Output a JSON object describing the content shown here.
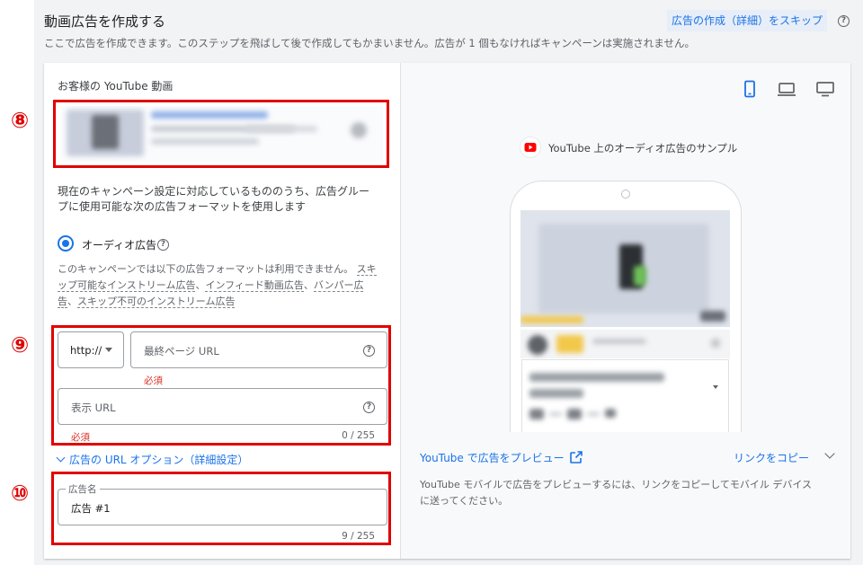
{
  "header": {
    "title": "動画広告を作成する",
    "description": "ここで広告を作成できます。このステップを飛ばして後で作成してもかまいません。広告が 1 個もなければキャンペーンは実施されません。",
    "skip_label": "広告の作成（詳細）をスキップ",
    "help_icon": "?"
  },
  "markers": {
    "m8": "⑧",
    "m9": "⑨",
    "m10": "⑩"
  },
  "left": {
    "video_section_label": "お客様の YouTube 動画",
    "format_intro_line1": "現在のキャンペーン設定に対応しているもののうち、広告グルー",
    "format_intro_line2": "プに使用可能な次の広告フォーマットを使用します",
    "audio_ad_label": "オーディオ広告",
    "unavail_line1_prefix": "このキャンペーンでは以下の広告フォーマットは利用できません。",
    "unavail_link_skip1": "スキ",
    "unavail_link_skip2": "ップ可能なインストリーム広告",
    "unavail_sep1": "、",
    "unavail_link_infeed": "インフィード動画広告",
    "unavail_sep2": "、",
    "unavail_link_bumper1": "バンパー広",
    "unavail_link_bumper2": "告",
    "unavail_sep3": "、",
    "unavail_link_nonskip": "スキップ不可のインストリーム広告",
    "protocol_value": "http://",
    "final_url_placeholder": "最終ページ URL",
    "required_label": "必須",
    "display_url_placeholder": "表示 URL",
    "display_url_counter": "0 / 255",
    "url_options_label": "広告の URL オプション（詳細設定）",
    "ad_name_label": "広告名",
    "ad_name_value": "広告 #1",
    "ad_name_counter": "9 / 255"
  },
  "right": {
    "sample_title": "YouTube 上のオーディオ広告のサンプル",
    "preview_on_youtube": "YouTube で広告をプレビュー",
    "copy_link": "リンクをコピー",
    "mobile_note_line1": "YouTube モバイルで広告をプレビューするには、リンクをコピーしてモバイル デバイス",
    "mobile_note_line2": "に送ってください。"
  },
  "colors": {
    "accent": "#1a73e8",
    "highlight_red": "#e00000",
    "required_red": "#d93025",
    "youtube_red": "#ff0000"
  }
}
